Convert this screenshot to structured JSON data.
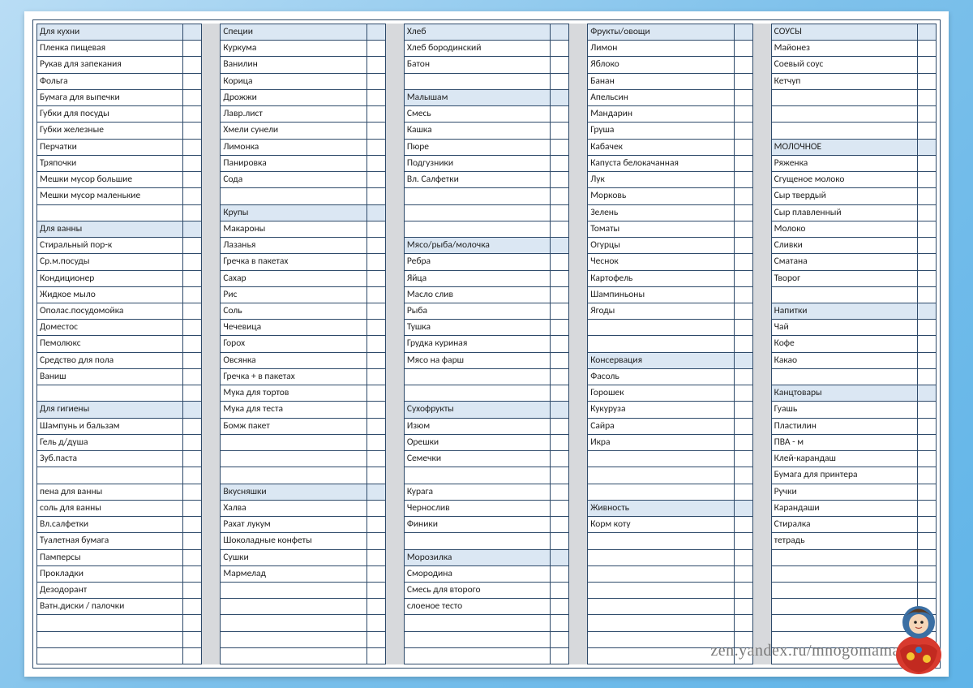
{
  "footer_url": "zen.yandex.ru/mnogomama",
  "columns": [
    [
      {
        "t": "h",
        "v": "Для кухни"
      },
      {
        "t": "i",
        "v": "Пленка пищевая"
      },
      {
        "t": "i",
        "v": "Рукав для запекания"
      },
      {
        "t": "i",
        "v": "Фольга"
      },
      {
        "t": "i",
        "v": "Бумага для выпечки"
      },
      {
        "t": "i",
        "v": "Губки для посуды"
      },
      {
        "t": "i",
        "v": "Губки железные"
      },
      {
        "t": "i",
        "v": "Перчатки"
      },
      {
        "t": "i",
        "v": "Тряпочки"
      },
      {
        "t": "i",
        "v": "Мешки мусор большие"
      },
      {
        "t": "i",
        "v": "Мешки мусор маленькие"
      },
      {
        "t": "i",
        "v": ""
      },
      {
        "t": "h",
        "v": "Для ванны"
      },
      {
        "t": "i",
        "v": "Стиральный пор-к"
      },
      {
        "t": "i",
        "v": "Ср.м.посуды"
      },
      {
        "t": "i",
        "v": "Кондиционер"
      },
      {
        "t": "i",
        "v": "Жидкое мыло"
      },
      {
        "t": "i",
        "v": "Ополас.посудомойка"
      },
      {
        "t": "i",
        "v": "Доместос"
      },
      {
        "t": "i",
        "v": "Пемолюкс"
      },
      {
        "t": "i",
        "v": "Средство для пола"
      },
      {
        "t": "i",
        "v": "Ваниш"
      },
      {
        "t": "i",
        "v": ""
      },
      {
        "t": "h",
        "v": "Для гигиены"
      },
      {
        "t": "i",
        "v": "Шампунь и бальзам"
      },
      {
        "t": "i",
        "v": "Гель д/душа"
      },
      {
        "t": "i",
        "v": "Зуб.паста"
      },
      {
        "t": "i",
        "v": ""
      },
      {
        "t": "i",
        "v": "пена для ванны"
      },
      {
        "t": "i",
        "v": "соль для ванны"
      },
      {
        "t": "i",
        "v": "Вл.салфетки"
      },
      {
        "t": "i",
        "v": "Туалетная бумага"
      },
      {
        "t": "i",
        "v": "Памперсы"
      },
      {
        "t": "i",
        "v": "Прокладки"
      },
      {
        "t": "i",
        "v": "Дезодорант"
      },
      {
        "t": "i",
        "v": "Ватн.диски / палочки"
      },
      {
        "t": "i",
        "v": ""
      },
      {
        "t": "i",
        "v": ""
      },
      {
        "t": "i",
        "v": ""
      }
    ],
    [
      {
        "t": "h",
        "v": "Специи"
      },
      {
        "t": "i",
        "v": "Куркума"
      },
      {
        "t": "i",
        "v": "Ванилин"
      },
      {
        "t": "i",
        "v": "Корица"
      },
      {
        "t": "i",
        "v": "Дрожжи"
      },
      {
        "t": "i",
        "v": "Лавр.лист"
      },
      {
        "t": "i",
        "v": "Хмели сунели"
      },
      {
        "t": "i",
        "v": "Лимонка"
      },
      {
        "t": "i",
        "v": "Панировка"
      },
      {
        "t": "i",
        "v": "Сода"
      },
      {
        "t": "i",
        "v": ""
      },
      {
        "t": "h",
        "v": "Крупы"
      },
      {
        "t": "i",
        "v": "Макароны"
      },
      {
        "t": "i",
        "v": "Лазанья"
      },
      {
        "t": "i",
        "v": "Гречка в пакетах"
      },
      {
        "t": "i",
        "v": "Сахар"
      },
      {
        "t": "i",
        "v": "Рис"
      },
      {
        "t": "i",
        "v": "Соль"
      },
      {
        "t": "i",
        "v": "Чечевица"
      },
      {
        "t": "i",
        "v": "Горох"
      },
      {
        "t": "i",
        "v": "Овсянка"
      },
      {
        "t": "i",
        "v": "Гречка + в пакетах"
      },
      {
        "t": "i",
        "v": "Мука для тортов"
      },
      {
        "t": "i",
        "v": "Мука для теста"
      },
      {
        "t": "i",
        "v": "Бомж пакет"
      },
      {
        "t": "i",
        "v": ""
      },
      {
        "t": "i",
        "v": ""
      },
      {
        "t": "i",
        "v": ""
      },
      {
        "t": "h",
        "v": "Вкусняшки"
      },
      {
        "t": "i",
        "v": "Халва"
      },
      {
        "t": "i",
        "v": "Рахат лукум"
      },
      {
        "t": "i",
        "v": "Шоколадные конфеты"
      },
      {
        "t": "i",
        "v": "Сушки"
      },
      {
        "t": "i",
        "v": "Мармелад"
      },
      {
        "t": "i",
        "v": ""
      },
      {
        "t": "i",
        "v": ""
      },
      {
        "t": "i",
        "v": ""
      },
      {
        "t": "i",
        "v": ""
      },
      {
        "t": "i",
        "v": ""
      }
    ],
    [
      {
        "t": "h",
        "v": "Хлеб"
      },
      {
        "t": "i",
        "v": "Хлеб бородинский"
      },
      {
        "t": "i",
        "v": "Батон"
      },
      {
        "t": "i",
        "v": ""
      },
      {
        "t": "h",
        "v": "Малышам"
      },
      {
        "t": "i",
        "v": "Смесь"
      },
      {
        "t": "i",
        "v": "Кашка"
      },
      {
        "t": "i",
        "v": "Пюре"
      },
      {
        "t": "i",
        "v": "Подгузники"
      },
      {
        "t": "i",
        "v": "Вл. Салфетки"
      },
      {
        "t": "i",
        "v": ""
      },
      {
        "t": "i",
        "v": ""
      },
      {
        "t": "i",
        "v": ""
      },
      {
        "t": "h",
        "v": "Мясо/рыба/молочка"
      },
      {
        "t": "i",
        "v": "Ребра"
      },
      {
        "t": "i",
        "v": "Яйца"
      },
      {
        "t": "i",
        "v": "Масло слив"
      },
      {
        "t": "i",
        "v": "Рыба"
      },
      {
        "t": "i",
        "v": "Тушка"
      },
      {
        "t": "i",
        "v": "Грудка куриная"
      },
      {
        "t": "i",
        "v": "Мясо на фарш"
      },
      {
        "t": "i",
        "v": ""
      },
      {
        "t": "i",
        "v": ""
      },
      {
        "t": "h",
        "v": "Сухофрукты"
      },
      {
        "t": "i",
        "v": "Изюм"
      },
      {
        "t": "i",
        "v": "Орешки"
      },
      {
        "t": "i",
        "v": "Семечки"
      },
      {
        "t": "i",
        "v": ""
      },
      {
        "t": "i",
        "v": "Курага"
      },
      {
        "t": "i",
        "v": "Чернослив"
      },
      {
        "t": "i",
        "v": "Финики"
      },
      {
        "t": "i",
        "v": ""
      },
      {
        "t": "h",
        "v": "Морозилка"
      },
      {
        "t": "i",
        "v": "Смородина"
      },
      {
        "t": "i",
        "v": "Смесь для второго"
      },
      {
        "t": "i",
        "v": "слоеное тесто"
      },
      {
        "t": "i",
        "v": ""
      },
      {
        "t": "i",
        "v": ""
      },
      {
        "t": "i",
        "v": ""
      }
    ],
    [
      {
        "t": "h",
        "v": "Фрукты/овощи"
      },
      {
        "t": "i",
        "v": "Лимон"
      },
      {
        "t": "i",
        "v": "Яблоко"
      },
      {
        "t": "i",
        "v": "Банан"
      },
      {
        "t": "i",
        "v": "Апельсин"
      },
      {
        "t": "i",
        "v": "Мандарин"
      },
      {
        "t": "i",
        "v": "Груша"
      },
      {
        "t": "i",
        "v": "Кабачек"
      },
      {
        "t": "i",
        "v": "Капуста белокачанная"
      },
      {
        "t": "i",
        "v": "Лук"
      },
      {
        "t": "i",
        "v": "Морковь"
      },
      {
        "t": "i",
        "v": "Зелень"
      },
      {
        "t": "i",
        "v": "Томаты"
      },
      {
        "t": "i",
        "v": "Огурцы"
      },
      {
        "t": "i",
        "v": "Чеснок"
      },
      {
        "t": "i",
        "v": "Картофель"
      },
      {
        "t": "i",
        "v": "Шампиньоны"
      },
      {
        "t": "i",
        "v": "Ягоды"
      },
      {
        "t": "i",
        "v": ""
      },
      {
        "t": "i",
        "v": ""
      },
      {
        "t": "h",
        "v": "Консервация"
      },
      {
        "t": "i",
        "v": "Фасоль"
      },
      {
        "t": "i",
        "v": "Горошек"
      },
      {
        "t": "i",
        "v": "Кукуруза"
      },
      {
        "t": "i",
        "v": "Сайра"
      },
      {
        "t": "i",
        "v": "Икра"
      },
      {
        "t": "i",
        "v": ""
      },
      {
        "t": "i",
        "v": ""
      },
      {
        "t": "i",
        "v": ""
      },
      {
        "t": "h",
        "v": "Живность"
      },
      {
        "t": "i",
        "v": "Корм коту"
      },
      {
        "t": "i",
        "v": ""
      },
      {
        "t": "i",
        "v": ""
      },
      {
        "t": "i",
        "v": ""
      },
      {
        "t": "i",
        "v": ""
      },
      {
        "t": "i",
        "v": ""
      },
      {
        "t": "i",
        "v": ""
      },
      {
        "t": "i",
        "v": ""
      },
      {
        "t": "i",
        "v": ""
      }
    ],
    [
      {
        "t": "h",
        "v": "СОУСЫ"
      },
      {
        "t": "i",
        "v": "Майонез"
      },
      {
        "t": "i",
        "v": "Соевый соус"
      },
      {
        "t": "i",
        "v": "Кетчуп"
      },
      {
        "t": "i",
        "v": ""
      },
      {
        "t": "i",
        "v": ""
      },
      {
        "t": "i",
        "v": ""
      },
      {
        "t": "h",
        "v": "МОЛОЧНОЕ"
      },
      {
        "t": "i",
        "v": "Ряженка"
      },
      {
        "t": "i",
        "v": "Сгущеное молоко"
      },
      {
        "t": "i",
        "v": "Сыр твердый"
      },
      {
        "t": "i",
        "v": "Сыр плавленный"
      },
      {
        "t": "i",
        "v": "Молоко"
      },
      {
        "t": "i",
        "v": "Сливки"
      },
      {
        "t": "i",
        "v": "Сматана"
      },
      {
        "t": "i",
        "v": "Творог"
      },
      {
        "t": "i",
        "v": ""
      },
      {
        "t": "h",
        "v": "Напитки"
      },
      {
        "t": "i",
        "v": "Чай"
      },
      {
        "t": "i",
        "v": "Кофе"
      },
      {
        "t": "i",
        "v": "Какао"
      },
      {
        "t": "i",
        "v": ""
      },
      {
        "t": "h",
        "v": "Канцтовары"
      },
      {
        "t": "i",
        "v": "Гуашь"
      },
      {
        "t": "i",
        "v": "Пластилин"
      },
      {
        "t": "i",
        "v": "ПВА - м"
      },
      {
        "t": "i",
        "v": "Клей-карандаш"
      },
      {
        "t": "i",
        "v": "Бумага для принтера"
      },
      {
        "t": "i",
        "v": "Ручки"
      },
      {
        "t": "i",
        "v": "Карандаши"
      },
      {
        "t": "i",
        "v": "Стиралка"
      },
      {
        "t": "i",
        "v": "тетрадь"
      },
      {
        "t": "i",
        "v": ""
      },
      {
        "t": "i",
        "v": ""
      },
      {
        "t": "i",
        "v": ""
      },
      {
        "t": "i",
        "v": ""
      },
      {
        "t": "i",
        "v": ""
      },
      {
        "t": "i",
        "v": ""
      },
      {
        "t": "i",
        "v": ""
      }
    ]
  ]
}
